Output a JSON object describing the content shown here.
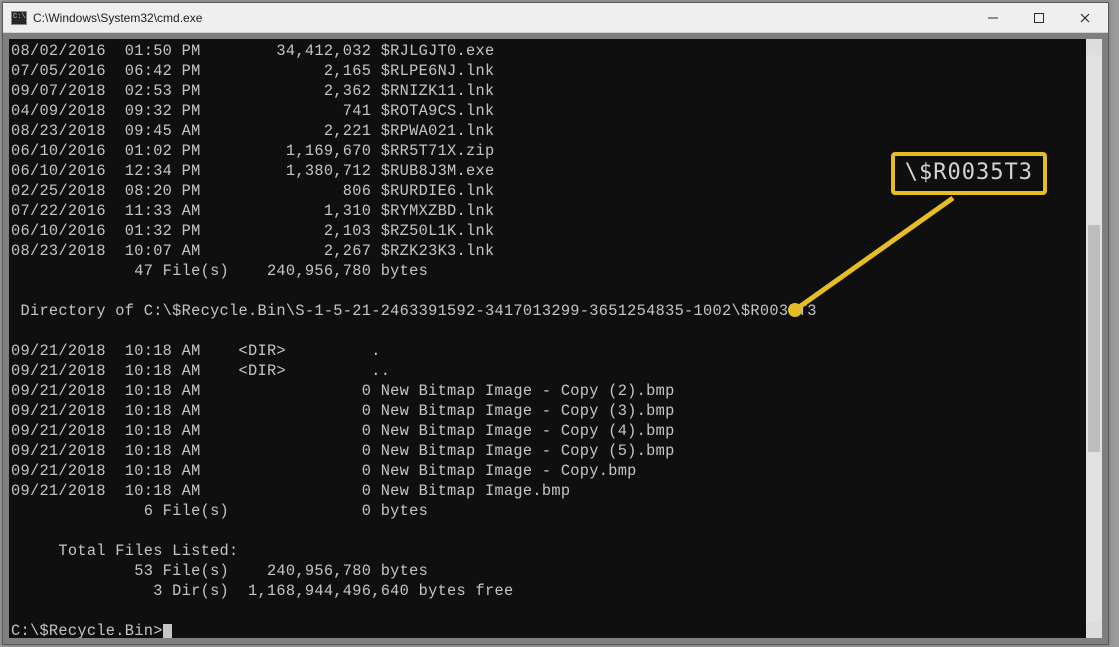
{
  "window": {
    "title": "C:\\Windows\\System32\\cmd.exe"
  },
  "callout": {
    "text": "\\$R0035T3"
  },
  "listing1": [
    {
      "date": "08/02/2016",
      "time": "01:50 PM",
      "size": "34,412,032",
      "name": "$RJLGJT0.exe"
    },
    {
      "date": "07/05/2016",
      "time": "06:42 PM",
      "size": "2,165",
      "name": "$RLPE6NJ.lnk"
    },
    {
      "date": "09/07/2018",
      "time": "02:53 PM",
      "size": "2,362",
      "name": "$RNIZK11.lnk"
    },
    {
      "date": "04/09/2018",
      "time": "09:32 PM",
      "size": "741",
      "name": "$ROTA9CS.lnk"
    },
    {
      "date": "08/23/2018",
      "time": "09:45 AM",
      "size": "2,221",
      "name": "$RPWA021.lnk"
    },
    {
      "date": "06/10/2016",
      "time": "01:02 PM",
      "size": "1,169,670",
      "name": "$RR5T71X.zip"
    },
    {
      "date": "06/10/2016",
      "time": "12:34 PM",
      "size": "1,380,712",
      "name": "$RUB8J3M.exe"
    },
    {
      "date": "02/25/2018",
      "time": "08:20 PM",
      "size": "806",
      "name": "$RURDIE6.lnk"
    },
    {
      "date": "07/22/2016",
      "time": "11:33 AM",
      "size": "1,310",
      "name": "$RYMXZBD.lnk"
    },
    {
      "date": "06/10/2016",
      "time": "01:32 PM",
      "size": "2,103",
      "name": "$RZ50L1K.lnk"
    },
    {
      "date": "08/23/2018",
      "time": "10:07 AM",
      "size": "2,267",
      "name": "$RZK23K3.lnk"
    }
  ],
  "summary1": {
    "files": "47 File(s)",
    "bytes": "240,956,780 bytes"
  },
  "dirHeader": " Directory of C:\\$Recycle.Bin\\S-1-5-21-2463391592-3417013299-3651254835-1002\\$R0035T3",
  "listing2": [
    {
      "date": "09/21/2018",
      "time": "10:18 AM",
      "dir": "<DIR>",
      "size": "",
      "name": "."
    },
    {
      "date": "09/21/2018",
      "time": "10:18 AM",
      "dir": "<DIR>",
      "size": "",
      "name": ".."
    },
    {
      "date": "09/21/2018",
      "time": "10:18 AM",
      "dir": "",
      "size": "0",
      "name": "New Bitmap Image - Copy (2).bmp"
    },
    {
      "date": "09/21/2018",
      "time": "10:18 AM",
      "dir": "",
      "size": "0",
      "name": "New Bitmap Image - Copy (3).bmp"
    },
    {
      "date": "09/21/2018",
      "time": "10:18 AM",
      "dir": "",
      "size": "0",
      "name": "New Bitmap Image - Copy (4).bmp"
    },
    {
      "date": "09/21/2018",
      "time": "10:18 AM",
      "dir": "",
      "size": "0",
      "name": "New Bitmap Image - Copy (5).bmp"
    },
    {
      "date": "09/21/2018",
      "time": "10:18 AM",
      "dir": "",
      "size": "0",
      "name": "New Bitmap Image - Copy.bmp"
    },
    {
      "date": "09/21/2018",
      "time": "10:18 AM",
      "dir": "",
      "size": "0",
      "name": "New Bitmap Image.bmp"
    }
  ],
  "summary2": {
    "files": "6 File(s)",
    "bytes": "0 bytes"
  },
  "totals": {
    "header": "     Total Files Listed:",
    "files": "53 File(s)",
    "filesBytes": "240,956,780 bytes",
    "dirs": "3 Dir(s)",
    "dirsBytes": "1,168,944,496,640 bytes free"
  },
  "prompt": "C:\\$Recycle.Bin>"
}
